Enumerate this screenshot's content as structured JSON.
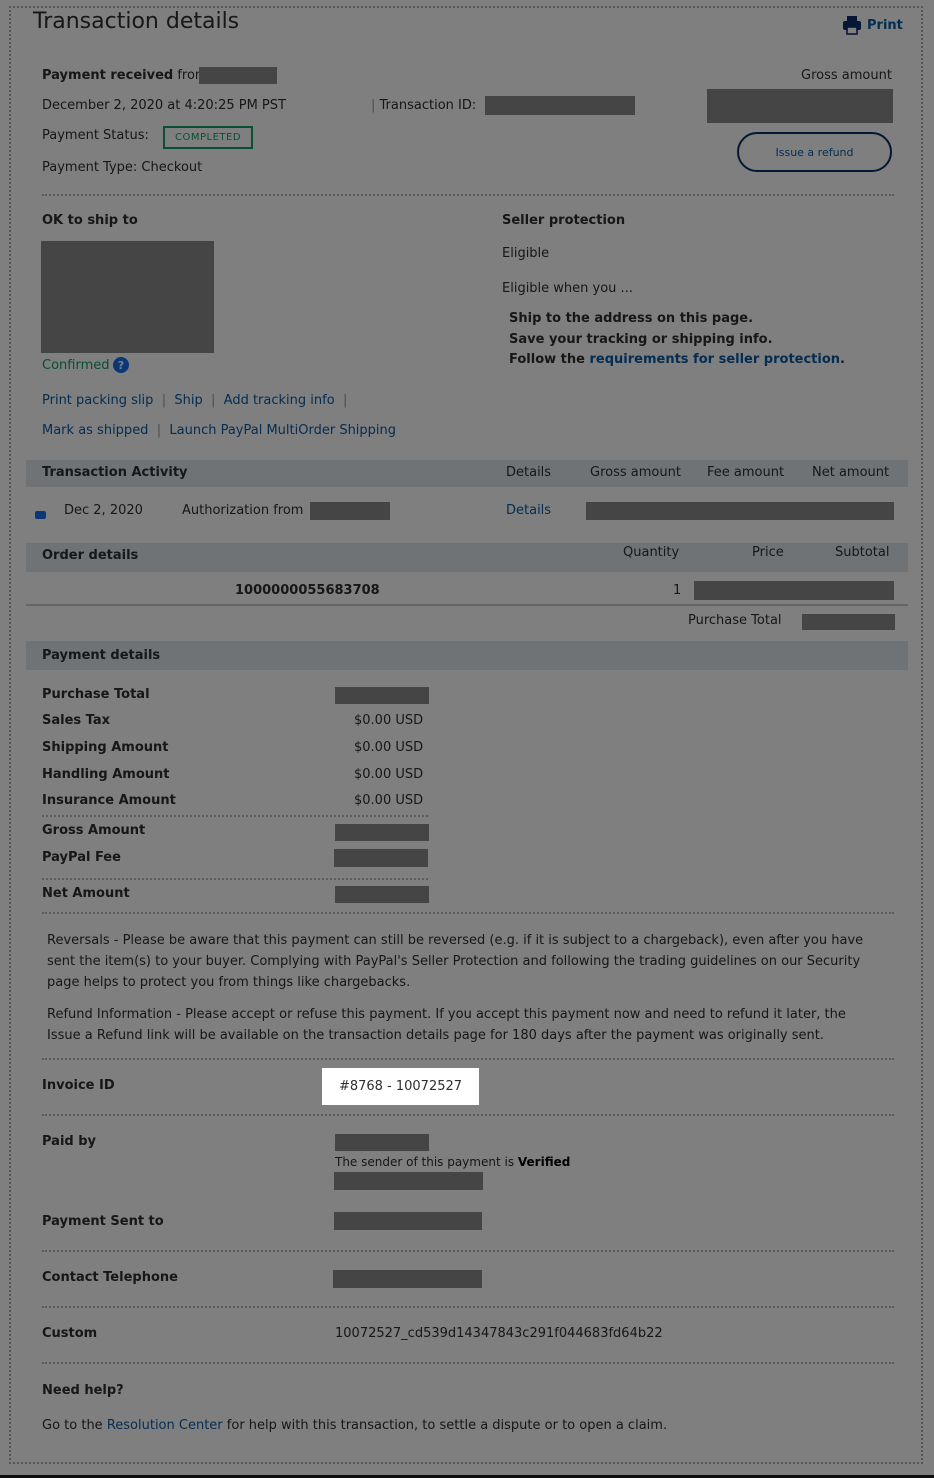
{
  "header": {
    "title": "Transaction details",
    "print_label": "Print"
  },
  "summary": {
    "payment_received_label": "Payment received",
    "from_label": "from",
    "datetime": "December 2, 2020 at 4:20:25 PM PST",
    "transaction_id_label": "Transaction ID:",
    "payment_status_label": "Payment Status:",
    "status_badge": "COMPLETED",
    "payment_type": "Payment Type: Checkout",
    "gross_amount_label": "Gross amount",
    "refund_button": "Issue a refund"
  },
  "shipping": {
    "ok_to_ship_label": "OK to ship to",
    "confirmed_label": "Confirmed",
    "help_glyph": "?",
    "actions": [
      "Print packing slip",
      "Ship",
      "Add tracking info",
      "Mark as shipped",
      "Launch PayPal MultiOrder Shipping"
    ]
  },
  "seller_protection": {
    "title": "Seller protection",
    "status": "Eligible",
    "eligible_when": "Eligible when you ...",
    "item1": "Ship to the address on this page.",
    "item2": "Save your tracking or shipping info.",
    "item3_prefix": "Follow the",
    "item3_link": "requirements for seller protection",
    "item3_suffix": "."
  },
  "activity": {
    "title": "Transaction Activity",
    "columns": [
      "Details",
      "Gross amount",
      "Fee amount",
      "Net amount"
    ],
    "row": {
      "date": "Dec 2, 2020",
      "description": "Authorization from",
      "details_link": "Details"
    }
  },
  "order": {
    "title": "Order details",
    "columns": [
      "Quantity",
      "Price",
      "Subtotal"
    ],
    "item_id": "1000000055683708",
    "quantity": "1",
    "purchase_total_label": "Purchase Total"
  },
  "payment_details": {
    "title": "Payment details",
    "rows": [
      {
        "label": "Purchase Total",
        "value": ""
      },
      {
        "label": "Sales Tax",
        "value": "$0.00 USD"
      },
      {
        "label": "Shipping Amount",
        "value": "$0.00 USD"
      },
      {
        "label": "Handling Amount",
        "value": "$0.00 USD"
      },
      {
        "label": "Insurance Amount",
        "value": "$0.00 USD"
      },
      {
        "label": "Gross Amount",
        "value": ""
      },
      {
        "label": "PayPal Fee",
        "value": ""
      },
      {
        "label": "Net Amount",
        "value": ""
      }
    ]
  },
  "notes": {
    "reversals": "Reversals - Please be aware that this payment can still be reversed (e.g. if it is subject to a chargeback), even after you have sent the item(s) to your buyer. Complying with PayPal's Seller Protection and following the trading guidelines on our Security page helps to protect you from things like chargebacks.",
    "refund": "Refund Information - Please accept or refuse this payment. If you accept this payment now and need to refund it later, the Issue a Refund link will be available on the transaction details page for 180 days after the payment was originally sent."
  },
  "invoice": {
    "label": "Invoice ID",
    "value": "#8768 - 10072527"
  },
  "paid_by": {
    "label": "Paid by",
    "sender_text": "The sender of this payment is",
    "verified": "Verified"
  },
  "sent_to": {
    "label": "Payment Sent to"
  },
  "telephone": {
    "label": "Contact Telephone"
  },
  "custom": {
    "label": "Custom",
    "value": "10072527_cd539d14347843c291f044683fd64b22"
  },
  "help": {
    "title": "Need help?",
    "prefix": "Go to the",
    "link": "Resolution Center",
    "suffix": "for help with this transaction, to settle a dispute or to open a claim."
  },
  "colors": {
    "link": "#0a5aa5",
    "status_green": "#11a063",
    "button_border": "#0b2f6a",
    "band": "#e1e7ec"
  }
}
